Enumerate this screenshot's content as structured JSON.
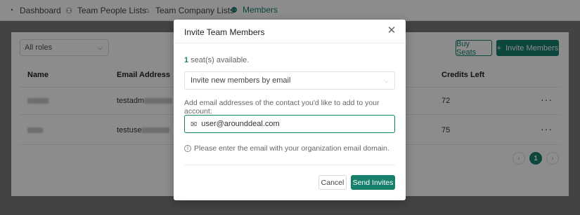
{
  "tabs": [
    {
      "label": "Dashboard",
      "icon": "dashboard-icon"
    },
    {
      "label": "Team People Lists",
      "icon": "person-icon"
    },
    {
      "label": "Team Company Lists",
      "icon": "bank-icon"
    },
    {
      "label": "Members",
      "icon": "members-icon",
      "active": true
    }
  ],
  "filters": {
    "role_select": "All roles"
  },
  "actions": {
    "buy_seats": "Buy Seats",
    "invite_members": "Invite Members"
  },
  "table": {
    "columns": [
      "Name",
      "Email Address",
      "Credits Left"
    ],
    "rows": [
      {
        "email_prefix": "testadm",
        "credits": "72"
      },
      {
        "email_prefix": "testuse",
        "credits": "75"
      }
    ],
    "row_menu": "···"
  },
  "pagination": {
    "current": "1",
    "prev": "‹",
    "next": "›"
  },
  "modal": {
    "title": "Invite Team Members",
    "seats_count": "1",
    "seats_text": " seat(s) available.",
    "method_select": "Invite new members by email",
    "hint": "Add email addresses of the contact you'd like to add to your account:",
    "email_value": "user@arounddeal.com",
    "note": "Please enter the email with your organization email domain.",
    "cancel": "Cancel",
    "send": "Send Invites"
  },
  "colors": {
    "accent": "#16806d"
  }
}
